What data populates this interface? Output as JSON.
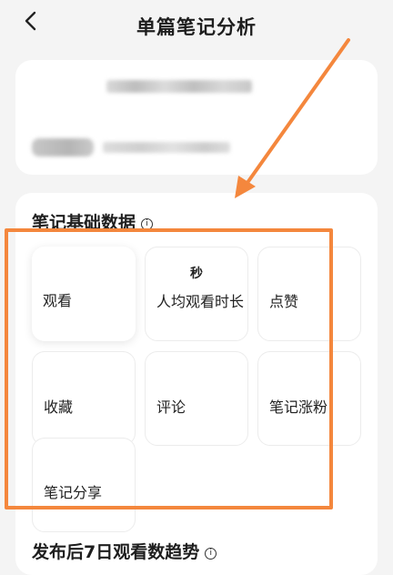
{
  "header": {
    "title": "单篇笔记分析",
    "back_icon": "chevron-left-icon"
  },
  "basic_data": {
    "title": "笔记基础数据",
    "info_icon": "info-icon",
    "metrics": [
      {
        "label": "观看",
        "unit": ""
      },
      {
        "label": "人均观看时长",
        "unit": "秒"
      },
      {
        "label": "点赞",
        "unit": ""
      },
      {
        "label": "收藏",
        "unit": ""
      },
      {
        "label": "评论",
        "unit": ""
      },
      {
        "label": "笔记涨粉",
        "unit": ""
      },
      {
        "label": "笔记分享",
        "unit": ""
      }
    ]
  },
  "trend": {
    "title": "发布后7日观看数趋势",
    "info_icon": "info-icon"
  },
  "annotation": {
    "color": "#f4873d"
  }
}
